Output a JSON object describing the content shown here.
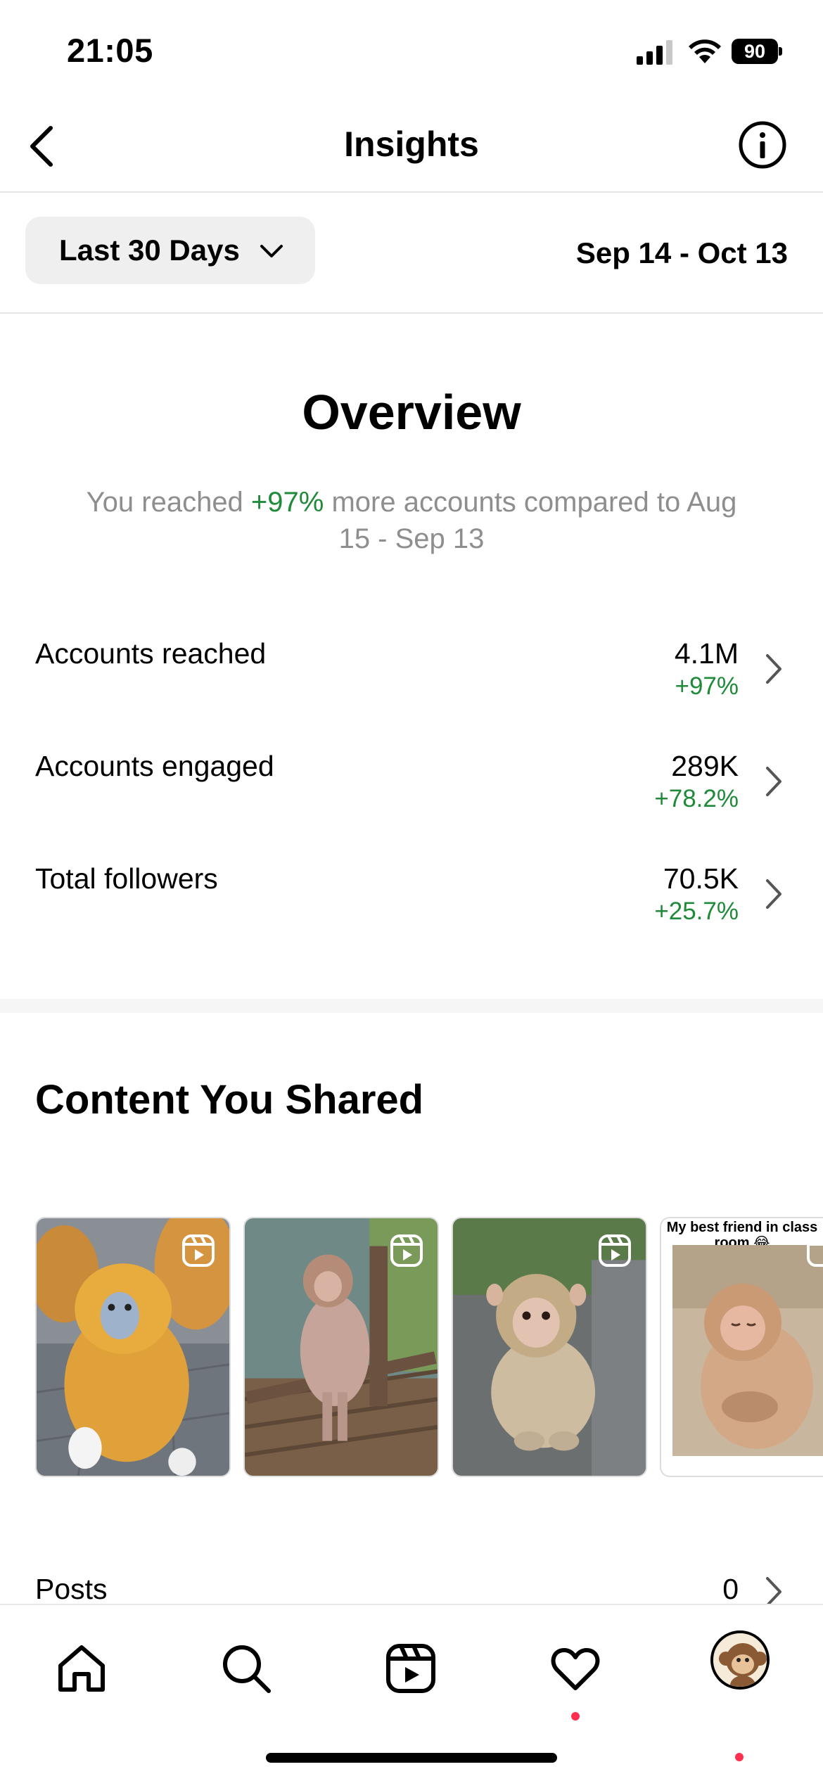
{
  "status_bar": {
    "time": "21:05",
    "battery": "90"
  },
  "header": {
    "title": "Insights"
  },
  "filter": {
    "range_label": "Last 30 Days",
    "date_range": "Sep 14 - Oct 13"
  },
  "overview": {
    "title": "Overview",
    "desc_prefix": "You reached ",
    "desc_highlight": "+97%",
    "desc_suffix": " more accounts compared to Aug 15 - Sep 13",
    "metrics": [
      {
        "label": "Accounts reached",
        "value": "4.1M",
        "change": "+97%"
      },
      {
        "label": "Accounts engaged",
        "value": "289K",
        "change": "+78.2%"
      },
      {
        "label": "Total followers",
        "value": "70.5K",
        "change": "+25.7%"
      }
    ]
  },
  "content": {
    "title": "Content You Shared",
    "thumbnails": [
      {
        "type": "reel"
      },
      {
        "type": "reel"
      },
      {
        "type": "reel"
      },
      {
        "type": "reel",
        "caption": "My best friend in class room 😂"
      }
    ],
    "posts_label": "Posts",
    "posts_value": "0"
  },
  "colors": {
    "positive": "#1f8a3a",
    "notification": "#ff2f4f"
  },
  "tab_bar": {
    "icons": [
      "home-icon",
      "search-icon",
      "reels-icon",
      "heart-icon",
      "profile-avatar"
    ]
  }
}
